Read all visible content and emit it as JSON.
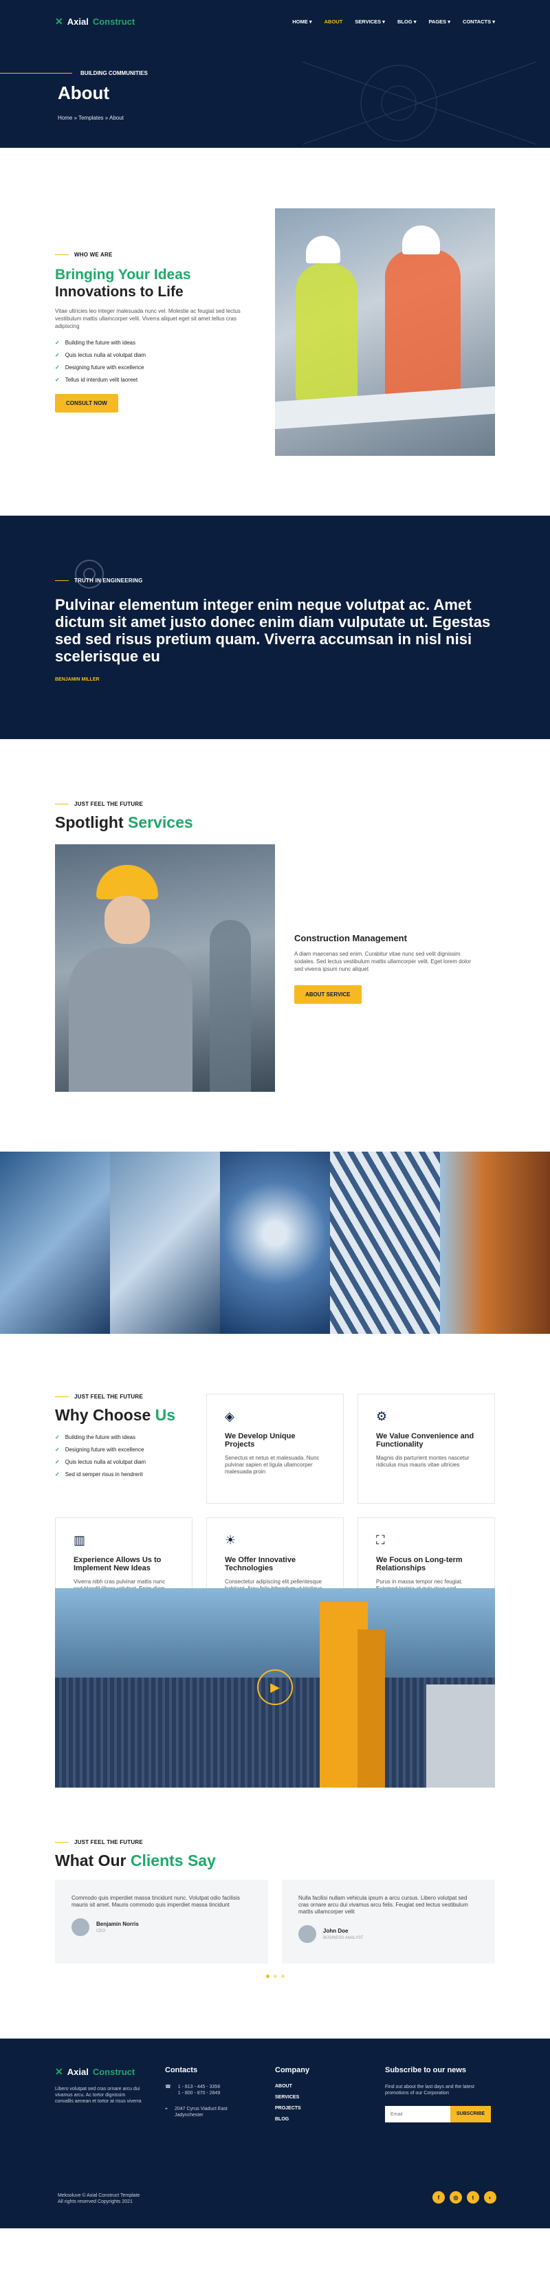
{
  "brand": {
    "name_a": "Axial",
    "name_b": "Construct"
  },
  "nav": [
    "HOME",
    "ABOUT",
    "SERVICES",
    "BLOG",
    "PAGES",
    "CONTACTS"
  ],
  "hero": {
    "kicker": "BUILDING COMMUNITIES",
    "title": "About",
    "crumbs": "Home » Templates » About"
  },
  "about": {
    "kicker": "WHO WE ARE",
    "title_green": "Bringing Your Ideas",
    "title_dark": "Innovations to Life",
    "body": "Vitae ultricies leo integer malesuada nunc vel. Molestie ac feugiat sed lectus vestibulum mattis ullamcorper velit. Viverra aliquet eget sit amet tellus cras adipiscing",
    "checks": [
      "Building the future with ideas",
      "Quis lectus nulla at volutpat diam",
      "Designing future with excellence",
      "Tellus id interdum velit laoreet"
    ],
    "button": "CONSULT NOW"
  },
  "quote": {
    "kicker": "TRUTH IN ENGINEERING",
    "text": "Pulvinar elementum integer enim neque volutpat ac. Amet dictum sit amet justo donec enim diam vulputate ut. Egestas sed sed risus pretium quam. Viverra accumsan in nisl nisi scelerisque eu",
    "author": "BENJAMIN MILLER"
  },
  "services": {
    "kicker": "JUST FEEL THE FUTURE",
    "title_a": "Spotlight",
    "title_b": "Services",
    "card_title": "Construction Management",
    "card_body": "A diam maecenas sed enim. Curabitur vitae nunc sed velit dignissim sodales. Sed lectus vestibulum mattis ullamcorper velit. Eget lorem dolor sed viverra ipsum nunc aliquet",
    "button": "ABOUT SERVICE"
  },
  "why": {
    "kicker": "JUST FEEL THE FUTURE",
    "title_a": "Why Choose",
    "title_b": "Us",
    "checks": [
      "Building the future with ideas",
      "Designing future with excellence",
      "Quis lectus nulla at volutpat diam",
      "Sed id semper risus in hendrerit"
    ],
    "cards": [
      {
        "icon": "layers-icon",
        "title": "We Develop Unique Projects",
        "body": "Senectus et netus et malesuada. Nunc pulvinar sapien et ligula ullamcorper malesuada proin"
      },
      {
        "icon": "gear-icon",
        "title": "We Value Convenience and Functionality",
        "body": "Magnis dis parturient montes nascetur ridiculus mus mauris vitae ultricies"
      },
      {
        "icon": "chart-icon",
        "title": "Experience Allows Us to Implement New Ideas",
        "body": "Viverra nibh cras pulvinar mattis nunc sed blandit libero volutpat. Enim diam vulputate ut pharetra"
      },
      {
        "icon": "bulb-icon",
        "title": "We Offer Innovative Technologies",
        "body": "Consectetur adipiscing elit pellentesque habitant. Arcu felis bibendum ut tristique"
      },
      {
        "icon": "handshake-icon",
        "title": "We Focus on Long-term Relationships",
        "body": "Purus in massa tempor nec feugiat. Euismod lacinia at quis risus sed vulputate odio"
      }
    ]
  },
  "testimonials": {
    "kicker": "JUST FEEL THE FUTURE",
    "title_a": "What Our",
    "title_b": "Clients Say",
    "items": [
      {
        "text": "Commodo quis imperdiet massa tincidunt nunc. Volutpat odio facilisis mauris sit amet. Mauris commodo quis imperdiet massa tincidunt",
        "name": "Benjamin Norris",
        "role": "CEO"
      },
      {
        "text": "Nulla facilisi nullam vehicula ipsum a arcu cursus. Libero volutpat sed cras ornare arcu dui vivamus arcu felis. Feugiat sed lectus vestibulum mattis ullamcorper velit",
        "name": "John Doe",
        "role": "BUSINESS ANALYST"
      }
    ]
  },
  "footer": {
    "about": "Libero volutpat sed cras ornare arcu dui vivamus arcu. Ac tortor dignissim convallis aenean et tortor at risus viverra",
    "contacts_title": "Contacts",
    "phone1": "1 - 813 - 445 - 3356",
    "phone2": "1 - 800 - 870 - 2849",
    "address": "2047 Cyrus Viaduct East Jadynchester",
    "company_title": "Company",
    "links": [
      "ABOUT",
      "SERVICES",
      "PROJECTS",
      "BLOG"
    ],
    "sub_title": "Subscribe to our news",
    "sub_text": "Find out about the last days and the latest promotions of our Corporation",
    "email_placeholder": "Email",
    "sub_button": "SUBSCRIBE",
    "copy1": "Meksoluve © Axial Construct Template",
    "copy2": "All rights reserved Copyrights 2021",
    "social": [
      "f",
      "◎",
      "t",
      "◐"
    ]
  },
  "colors": {
    "navy": "#0c1e3d",
    "green": "#1fa86b",
    "yellow": "#f6b922"
  }
}
